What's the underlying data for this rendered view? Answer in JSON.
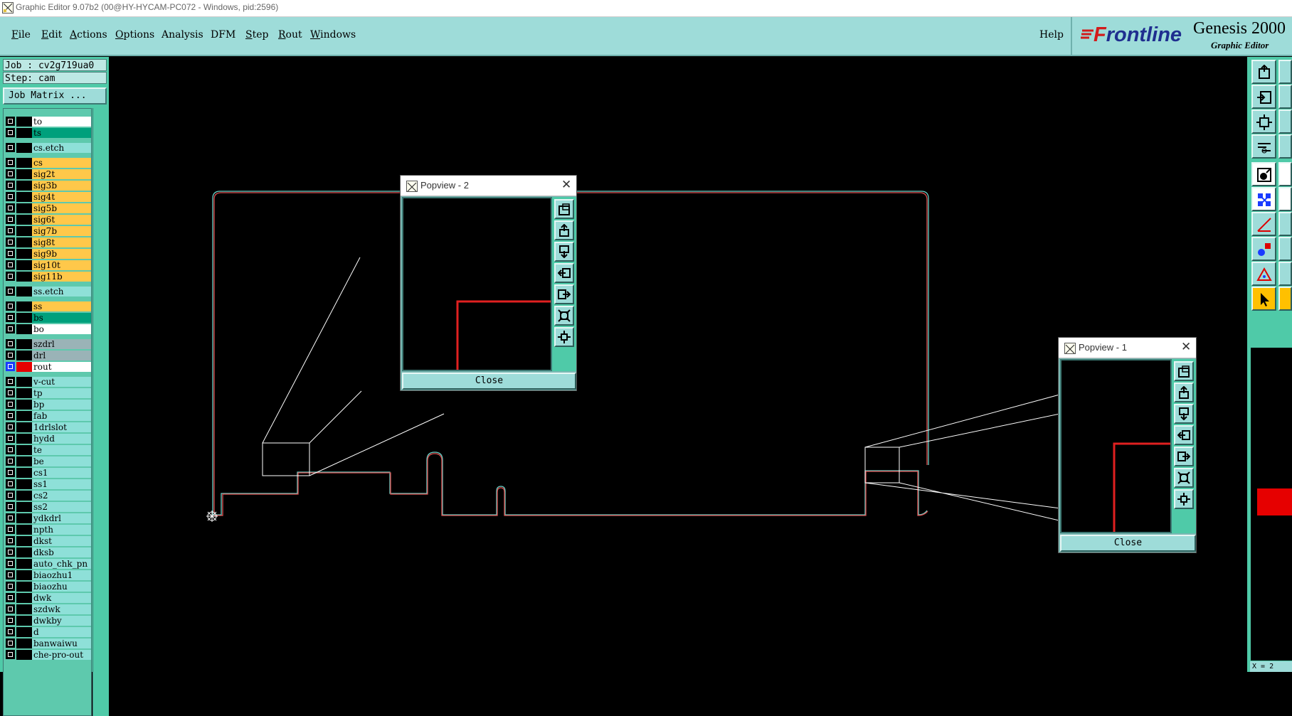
{
  "window": {
    "title": "Graphic Editor 9.07b2 (00@HY-HYCAM-PC072 - Windows, pid:2596)"
  },
  "menu": {
    "items": [
      {
        "label": "File",
        "accel": "F",
        "rest": "ile"
      },
      {
        "label": "Edit",
        "accel": "E",
        "rest": "dit"
      },
      {
        "label": "Actions",
        "accel": "A",
        "rest": "ctions"
      },
      {
        "label": "Options",
        "accel": "O",
        "rest": "ptions"
      },
      {
        "label": "Analysis",
        "accel": "",
        "rest": "Analysis"
      },
      {
        "label": "DFM",
        "accel": "",
        "rest": "DFM"
      },
      {
        "label": "Step",
        "accel": "S",
        "rest": "tep"
      },
      {
        "label": "Rout",
        "accel": "R",
        "rest": "out"
      },
      {
        "label": "Windows",
        "accel": "W",
        "rest": "indows"
      }
    ],
    "help": "Help"
  },
  "brand": {
    "logo_f": "F",
    "logo_rest": "rontline",
    "product": "Genesis 2000",
    "subtitle": "Graphic Editor"
  },
  "job": {
    "job_text": "Job : cv2g719ua0",
    "step_text": "Step: cam",
    "matrix_button": "Job Matrix ..."
  },
  "layers": [
    {
      "name": "to",
      "style": "board"
    },
    {
      "name": "ts",
      "style": "green"
    },
    {
      "name": "cs.etch",
      "style": "etch"
    },
    {
      "name": "cs",
      "style": "sig"
    },
    {
      "name": "sig2t",
      "style": "sig"
    },
    {
      "name": "sig3b",
      "style": "sig"
    },
    {
      "name": "sig4t",
      "style": "sig"
    },
    {
      "name": "sig5b",
      "style": "sig"
    },
    {
      "name": "sig6t",
      "style": "sig"
    },
    {
      "name": "sig7b",
      "style": "sig"
    },
    {
      "name": "sig8t",
      "style": "sig"
    },
    {
      "name": "sig9b",
      "style": "sig"
    },
    {
      "name": "sig10t",
      "style": "sig"
    },
    {
      "name": "sig11b",
      "style": "sig"
    },
    {
      "name": "ss.etch",
      "style": "etch"
    },
    {
      "name": "ss",
      "style": "sig"
    },
    {
      "name": "bs",
      "style": "green"
    },
    {
      "name": "bo",
      "style": "board"
    },
    {
      "name": "szdrl",
      "style": "drl"
    },
    {
      "name": "drl",
      "style": "drl"
    },
    {
      "name": "rout",
      "style": "rout",
      "active": true
    },
    {
      "name": "v-cut",
      "style": "misc"
    },
    {
      "name": "tp",
      "style": "misc"
    },
    {
      "name": "bp",
      "style": "misc"
    },
    {
      "name": "fab",
      "style": "misc"
    },
    {
      "name": "1drlslot",
      "style": "misc"
    },
    {
      "name": "hydd",
      "style": "misc"
    },
    {
      "name": "te",
      "style": "misc"
    },
    {
      "name": "be",
      "style": "misc"
    },
    {
      "name": "cs1",
      "style": "misc"
    },
    {
      "name": "ss1",
      "style": "misc"
    },
    {
      "name": "cs2",
      "style": "misc"
    },
    {
      "name": "ss2",
      "style": "misc"
    },
    {
      "name": "ydkdrl",
      "style": "misc"
    },
    {
      "name": "npth",
      "style": "misc"
    },
    {
      "name": "dkst",
      "style": "misc"
    },
    {
      "name": "dksb",
      "style": "misc"
    },
    {
      "name": "auto_chk_pn",
      "style": "misc"
    },
    {
      "name": "biaozhu1",
      "style": "misc"
    },
    {
      "name": "biaozhu",
      "style": "misc"
    },
    {
      "name": "dwk",
      "style": "misc"
    },
    {
      "name": "szdwk",
      "style": "misc"
    },
    {
      "name": "dwkby",
      "style": "misc"
    },
    {
      "name": "d",
      "style": "misc"
    },
    {
      "name": "banwaiwu",
      "style": "misc"
    },
    {
      "name": "che-pro-out",
      "style": "misc"
    }
  ],
  "popviews": [
    {
      "title": "Popview - 2",
      "close_label": "Close"
    },
    {
      "title": "Popview - 1",
      "close_label": "Close"
    }
  ],
  "colors": {
    "panel": "#4fcaa8",
    "menu": "#9edcd9",
    "outline_cyan": "#6ad1c8",
    "outline_red": "#e05050",
    "rout_red": "#e02020",
    "highlight_yellow": "#ffc84a"
  },
  "coord_readout": "X = 2"
}
